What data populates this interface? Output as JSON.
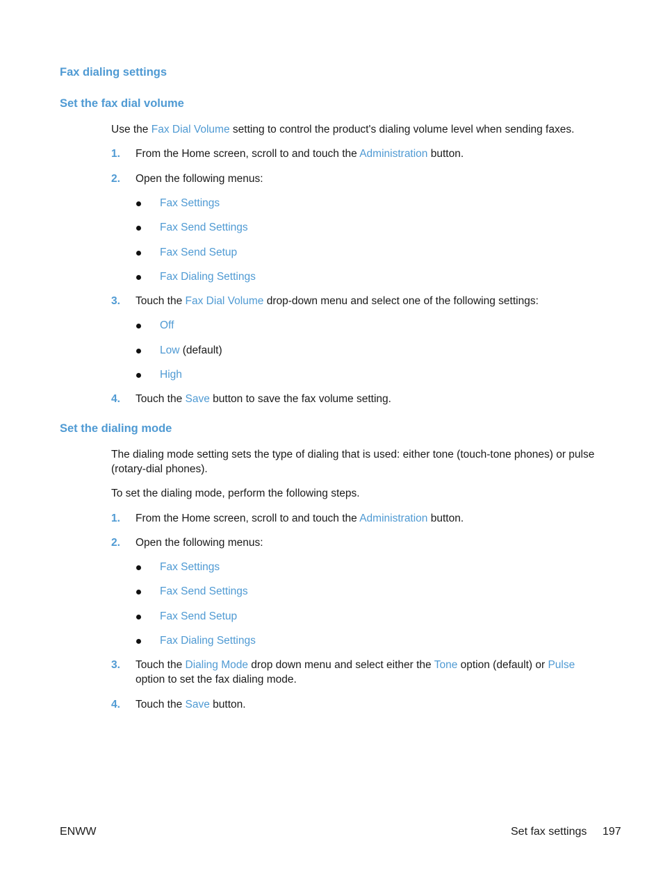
{
  "section_title": "Fax dialing settings",
  "volume": {
    "heading": "Set the fax dial volume",
    "intro": {
      "pre": "Use the ",
      "link": "Fax Dial Volume",
      "post": " setting to control the product's dialing volume level when sending faxes."
    },
    "steps": [
      {
        "num": "1.",
        "pre": "From the Home screen, scroll to and touch the ",
        "link": "Administration",
        "post": " button."
      },
      {
        "num": "2.",
        "text": "Open the following menus:"
      },
      {
        "num": "3.",
        "pre": "Touch the ",
        "link": "Fax Dial Volume",
        "post": " drop-down menu and select one of the following settings:"
      },
      {
        "num": "4.",
        "pre": "Touch the ",
        "link": "Save",
        "post": " button to save the fax volume setting."
      }
    ],
    "menus": [
      "Fax Settings",
      "Fax Send Settings",
      "Fax Send Setup",
      "Fax Dialing Settings"
    ],
    "options": [
      {
        "label": "Off",
        "suffix": ""
      },
      {
        "label": "Low",
        "suffix": " (default)"
      },
      {
        "label": "High",
        "suffix": ""
      }
    ]
  },
  "mode": {
    "heading": "Set the dialing mode",
    "intro1": "The dialing mode setting sets the type of dialing that is used: either tone (touch-tone phones) or pulse (rotary-dial phones).",
    "intro2": "To set the dialing mode, perform the following steps.",
    "steps": [
      {
        "num": "1.",
        "pre": "From the Home screen, scroll to and touch the ",
        "link": "Administration",
        "post": " button."
      },
      {
        "num": "2.",
        "text": "Open the following menus:"
      },
      {
        "num": "3.",
        "pre": "Touch the ",
        "link": "Dialing Mode",
        "mid1": " drop down menu and select either the ",
        "link2": "Tone",
        "mid2": " option (default) or ",
        "link3": "Pulse",
        "post": " option to set the fax dialing mode."
      },
      {
        "num": "4.",
        "pre": "Touch the ",
        "link": "Save",
        "post": " button."
      }
    ],
    "menus": [
      "Fax Settings",
      "Fax Send Settings",
      "Fax Send Setup",
      "Fax Dialing Settings"
    ]
  },
  "footer": {
    "left": "ENWW",
    "section": "Set fax settings",
    "page": "197"
  },
  "colors": {
    "accent": "#4f9ad3",
    "text": "#1a1a1a"
  }
}
